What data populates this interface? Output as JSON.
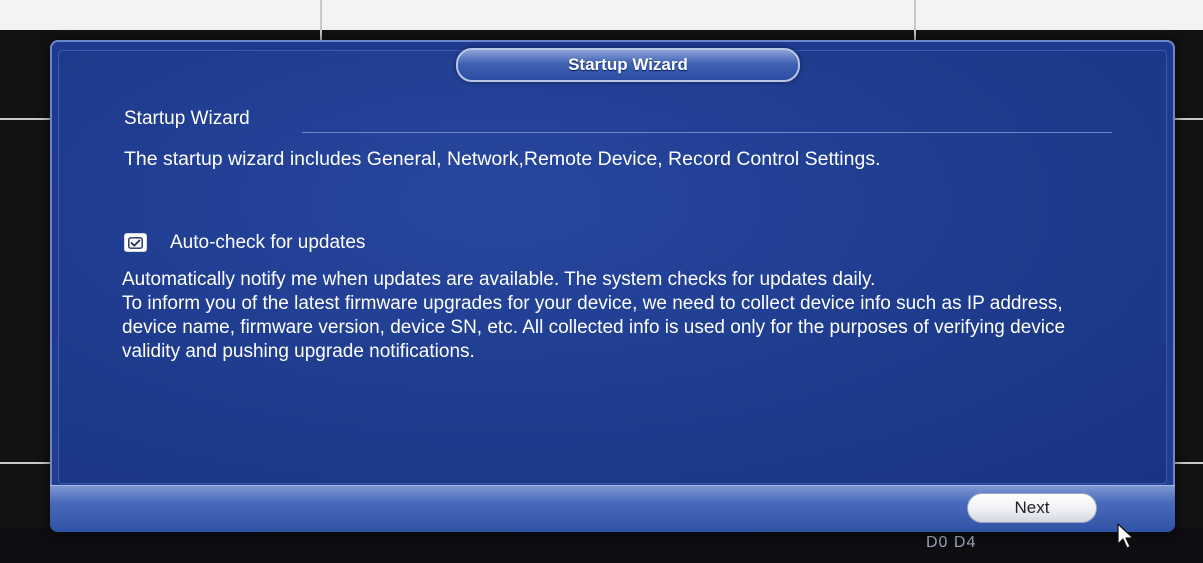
{
  "dialog": {
    "title": "Startup Wizard",
    "section_heading": "Startup Wizard",
    "intro": "The startup wizard includes General, Network,Remote Device, Record Control Settings."
  },
  "auto_check": {
    "label": "Auto-check for updates",
    "checked": true
  },
  "body": {
    "paragraph1": "Automatically notify me when updates are available. The system checks for updates daily.",
    "paragraph2": "To inform you of the latest firmware upgrades for your device, we need to collect device info such as IP address, device name, firmware version, device SN, etc. All collected info is used only for the purposes of verifying device validity and pushing upgrade notifications."
  },
  "footer": {
    "next_label": "Next"
  },
  "background": {
    "bottom_text": "D0 D4"
  },
  "colors": {
    "dialog_blue": "#1f3a8c",
    "accent_light": "#8ea4d6",
    "text": "#ffffff"
  },
  "icons": {
    "checkbox": "check-icon",
    "cursor": "mouse-pointer-icon"
  }
}
